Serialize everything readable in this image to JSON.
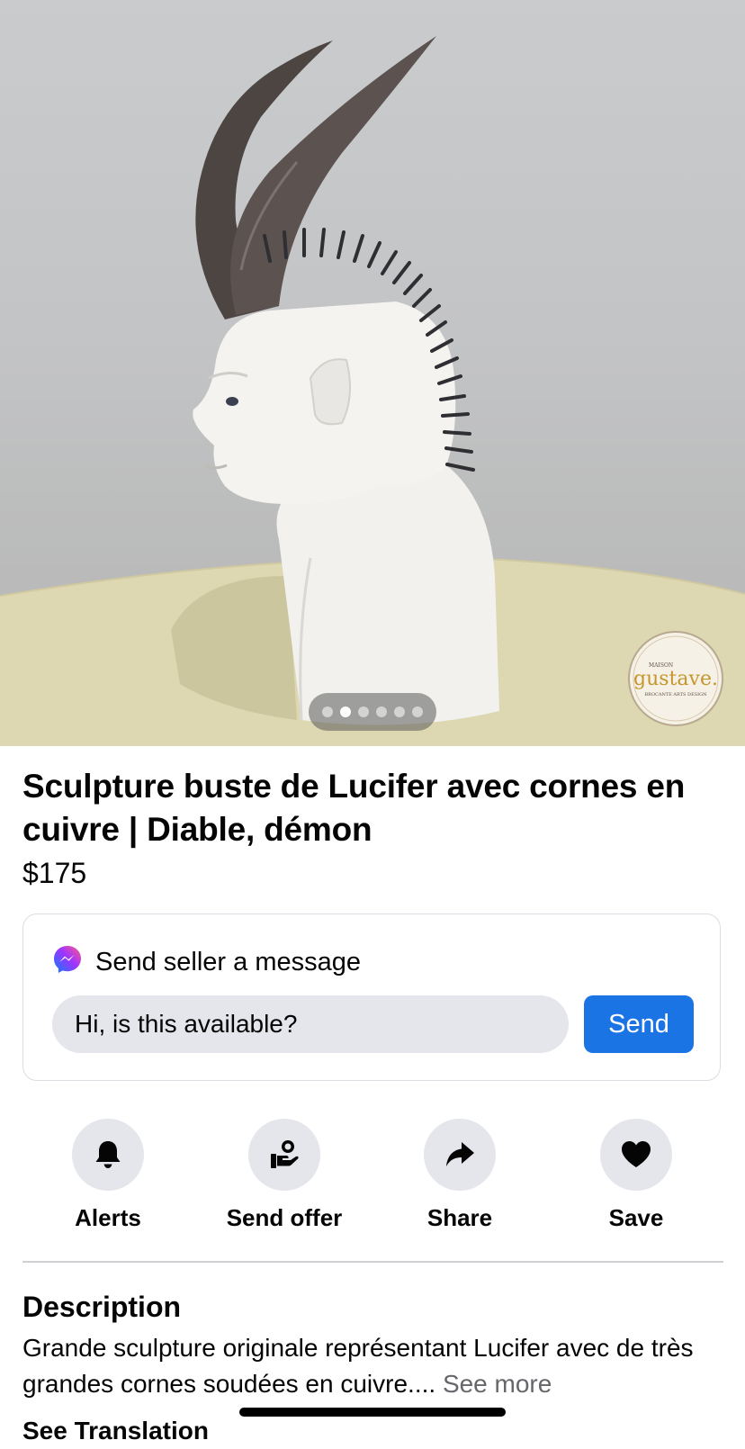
{
  "listing": {
    "title": "Sculpture buste de Lucifer avec cornes en cuivre | Diable, démon",
    "price": "$175",
    "photo": {
      "subject": "lucifer-bust-sculpture-photo",
      "photo_count": 6,
      "active_index": 1,
      "watermark": {
        "top_text": "MAISON",
        "name": "gustave.",
        "bottom_text": "BROCANTE ARTS DESIGN"
      }
    }
  },
  "message_card": {
    "header": "Send seller a message",
    "icon": "messenger-icon",
    "input_value": "Hi, is this available?",
    "send_label": "Send",
    "accent_color": "#1b74e4"
  },
  "actions": [
    {
      "label": "Alerts",
      "icon": "bell-icon"
    },
    {
      "label": "Send offer",
      "icon": "offer-icon"
    },
    {
      "label": "Share",
      "icon": "share-arrow-icon"
    },
    {
      "label": "Save",
      "icon": "heart-icon"
    }
  ],
  "description": {
    "heading": "Description",
    "text": "Grande sculpture originale représentant Lucifer avec de très grandes cornes soudées en cuivre....",
    "see_more": "See more",
    "see_translation": "See Translation"
  }
}
